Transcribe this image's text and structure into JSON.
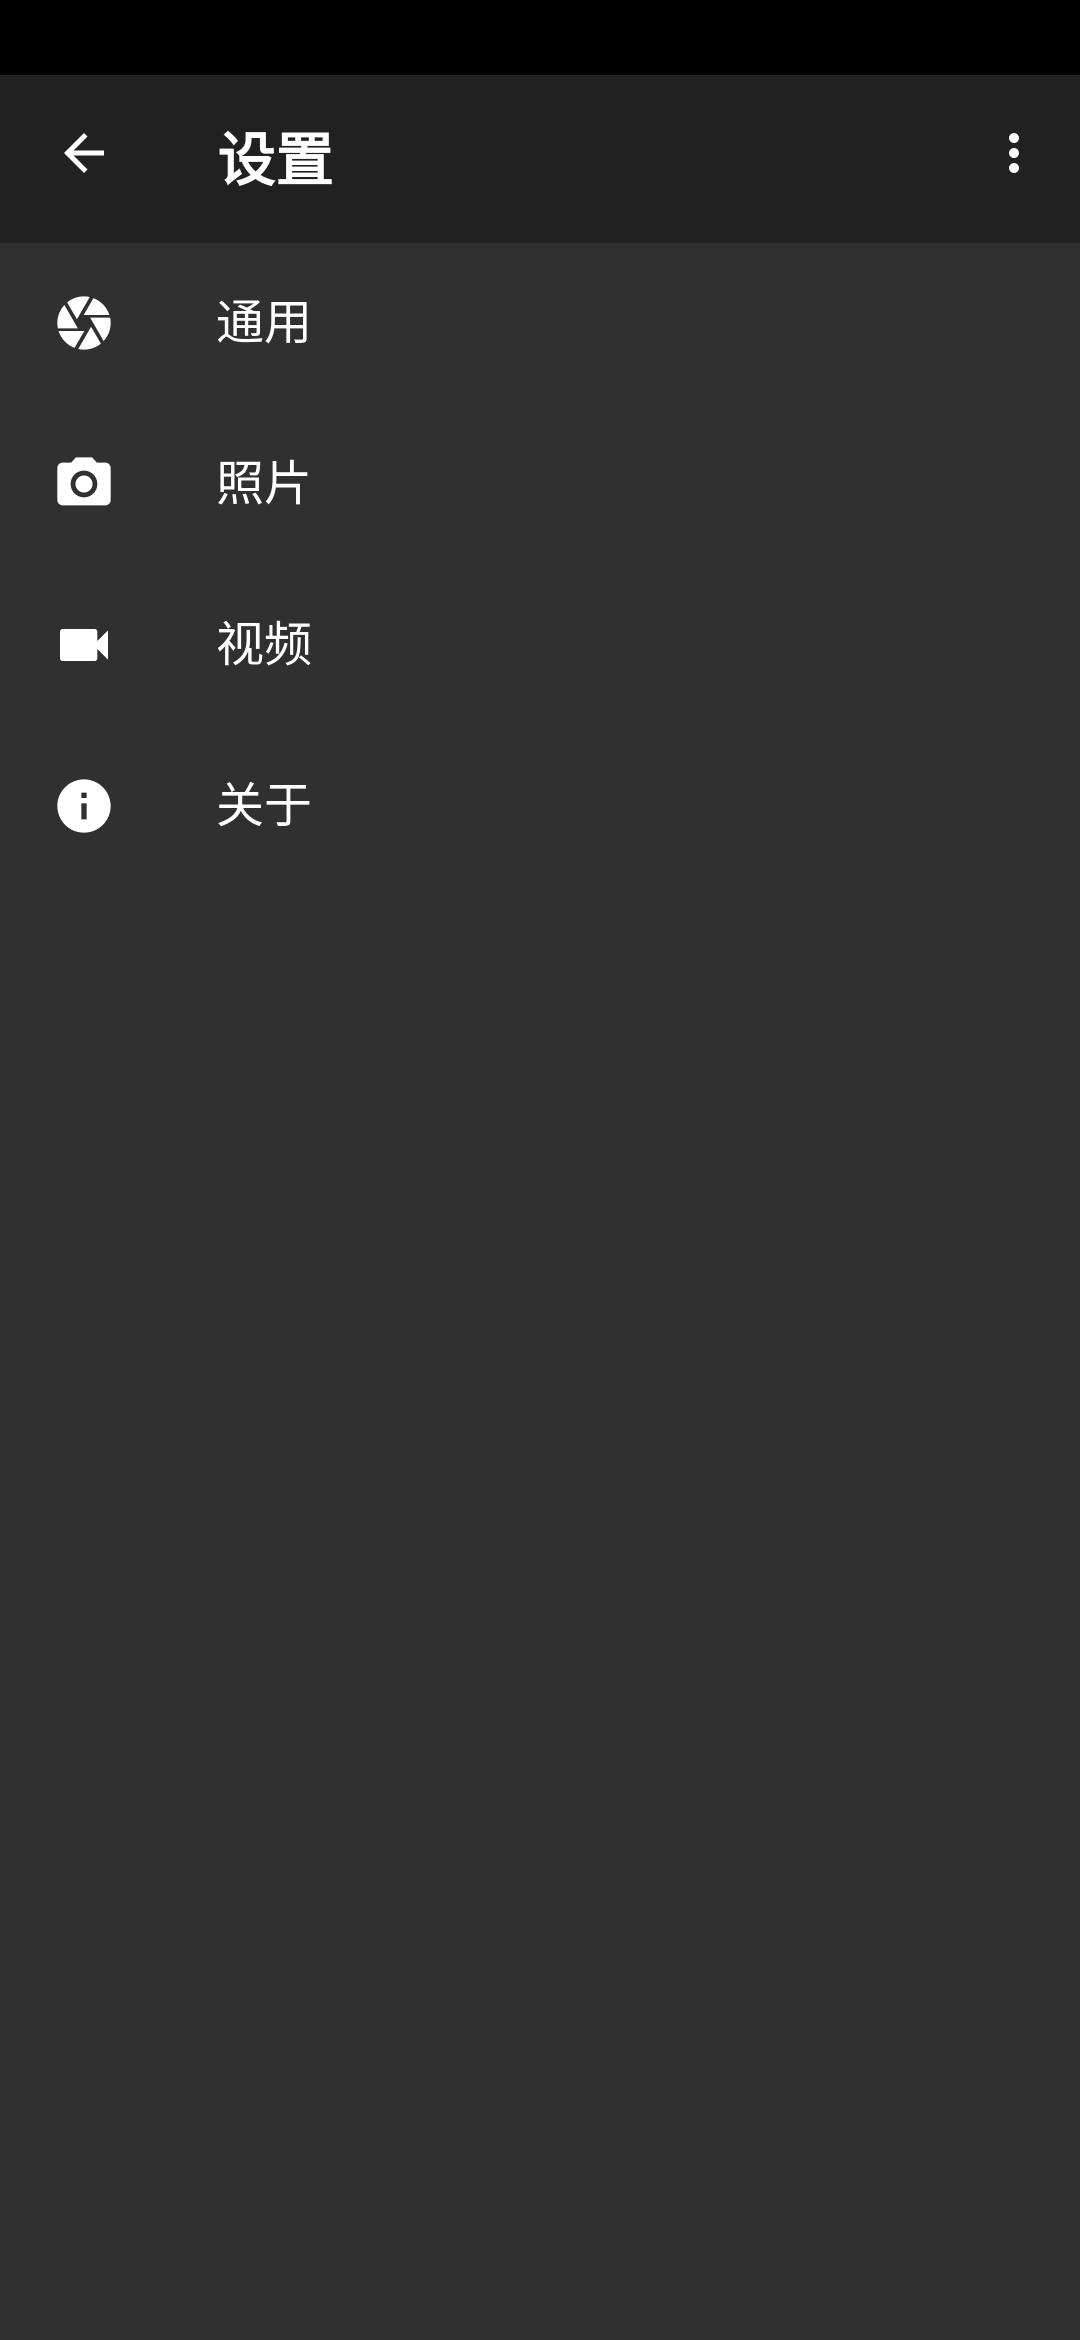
{
  "app_bar": {
    "title": "设置",
    "back_icon": "arrow-back-icon",
    "overflow_icon": "more-vertical-icon"
  },
  "settings": {
    "items": [
      {
        "label": "通用",
        "icon": "camera-aperture-icon"
      },
      {
        "label": "照片",
        "icon": "camera-icon"
      },
      {
        "label": "视频",
        "icon": "videocam-icon"
      },
      {
        "label": "关于",
        "icon": "info-icon"
      }
    ]
  },
  "colors": {
    "status_bar": "#000000",
    "app_bar": "#212121",
    "background": "#303030",
    "foreground": "#ffffff"
  }
}
